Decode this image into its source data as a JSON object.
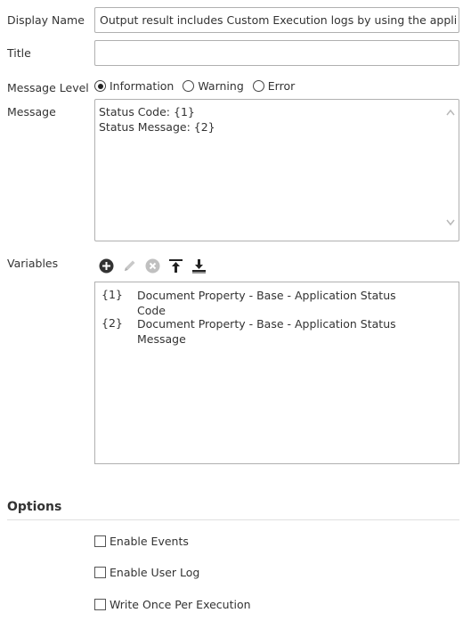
{
  "fields": {
    "display_name": {
      "label": "Display Name",
      "value": "Output result includes Custom Execution logs by using the applicati"
    },
    "title": {
      "label": "Title",
      "value": ""
    },
    "message_level": {
      "label": "Message Level",
      "options": [
        "Information",
        "Warning",
        "Error"
      ],
      "selected": "Information"
    },
    "message": {
      "label": "Message",
      "lines": [
        "Status Code: {1}",
        "Status Message: {2}"
      ]
    }
  },
  "variables": {
    "label": "Variables",
    "toolbar_icons": [
      "add-icon",
      "edit-icon",
      "remove-icon",
      "move-top-icon",
      "move-bottom-icon"
    ],
    "rows": [
      {
        "key": "{1}",
        "lines": [
          "Document Property - Base - Application Status Code"
        ]
      },
      {
        "key": "{2}",
        "lines": [
          "Document Property - Base - Application Status",
          "Message"
        ]
      }
    ]
  },
  "options": {
    "heading": "Options",
    "checkboxes": [
      {
        "label": "Enable Events",
        "checked": false
      },
      {
        "label": "Enable User Log",
        "checked": false
      },
      {
        "label": "Write Once Per Execution",
        "checked": false
      }
    ]
  }
}
